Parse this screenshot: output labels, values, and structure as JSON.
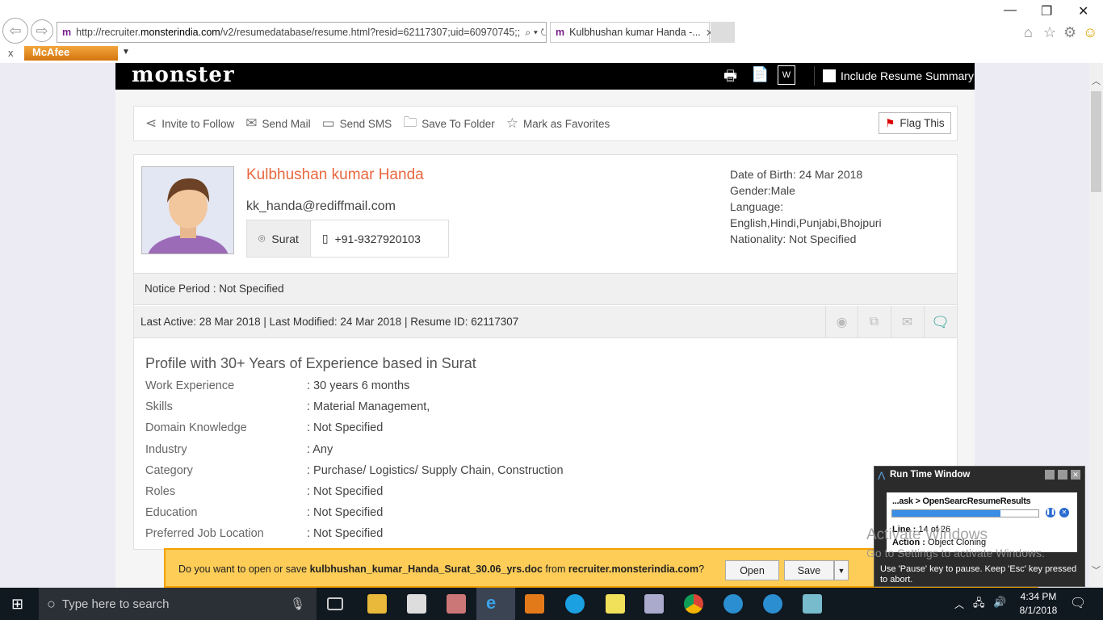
{
  "browser": {
    "url_prefix": "http://recruiter.",
    "url_domain": "monsterindia.com",
    "url_path": "/v2/resumedatabase/resume.html?resid=62117307;uid=60970745;;",
    "tab_title": "Kulbhushan kumar Handa -...",
    "toolbar_addon": "McAfee"
  },
  "header": {
    "logo": "monster",
    "include_summary": "Include Resume Summary"
  },
  "actions": [
    {
      "icon": "share-icon",
      "label": "Invite to Follow"
    },
    {
      "icon": "mail-icon",
      "label": "Send Mail"
    },
    {
      "icon": "sms-icon",
      "label": "Send SMS"
    },
    {
      "icon": "folder-icon",
      "label": "Save To Folder"
    },
    {
      "icon": "star-icon",
      "label": "Mark as Favorites"
    }
  ],
  "flag": "Flag This",
  "profile": {
    "name": "Kulbhushan kumar Handa",
    "email": "kk_handa@rediffmail.com",
    "location": "Surat",
    "phone": "+91-9327920103",
    "dob": "Date of Birth: 24 Mar 2018",
    "gender": "Gender:Male",
    "language_label": "Language:",
    "languages": "English,Hindi,Punjabi,Bhojpuri",
    "nationality": "Nationality: Not Specified",
    "notice": "Notice Period : Not Specified",
    "activity": "Last Active: 28 Mar 2018 | Last Modified: 24 Mar 2018 | Resume ID: 62117307",
    "summary_title": "Profile with 30+ Years of Experience based in Surat",
    "details": [
      {
        "k": "Work Experience",
        "v": ": 30 years 6 months"
      },
      {
        "k": "Skills",
        "v": ": Material Management,"
      },
      {
        "k": "Domain Knowledge",
        "v": ": Not Specified"
      },
      {
        "k": "Industry",
        "v": ": Any"
      },
      {
        "k": "Category",
        "v": ": Purchase/ Logistics/ Supply Chain, Construction"
      },
      {
        "k": "Roles",
        "v": ": Not Specified"
      },
      {
        "k": "Education",
        "v": ": Not Specified"
      },
      {
        "k": "Preferred Job Location",
        "v": ": Not Specified"
      }
    ]
  },
  "download": {
    "pre": "Do you want to open or save ",
    "file": "kulbhushan_kumar_Handa_Surat_30.06_yrs.doc",
    "mid": " from ",
    "site": "recruiter.monsterindia.com",
    "post": "?",
    "open": "Open",
    "save": "Save"
  },
  "runtime": {
    "title": "Run Time Window",
    "task": "...ask > OpenSearcResumeResults",
    "progress": 0.74,
    "line_label": "Line :",
    "line": "14 of 26",
    "action_label": "Action :",
    "action": "Object Cloning",
    "hint": "Use 'Pause' key to pause. Keep 'Esc' key pressed to abort."
  },
  "watermark": {
    "l1": "Activate Windows",
    "l2": "Go to Settings to activate Windows."
  },
  "taskbar": {
    "search": "Type here to search",
    "time": "4:34 PM",
    "date": "8/1/2018"
  }
}
